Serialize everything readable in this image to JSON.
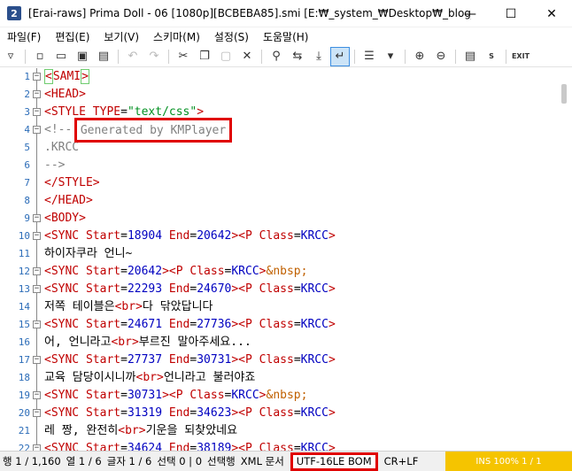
{
  "window": {
    "title": "[Erai-raws] Prima Doll - 06 [1080p][BCBEBA85].smi [E:₩_system_₩Desktop₩_blog_te...",
    "app_icon": "2",
    "controls": [
      "—",
      "☐",
      "✕"
    ]
  },
  "menu": [
    "파일(F)",
    "편집(E)",
    "보기(V)",
    "스키마(M)",
    "설정(S)",
    "도움말(H)"
  ],
  "toolbar": {
    "exit_label": "EXIT",
    "s_label": "S"
  },
  "editor": {
    "lines": [
      {
        "num": "1",
        "fold": "box-minus",
        "segments": [
          {
            "cls": "tag brace-box",
            "t": "<"
          },
          {
            "cls": "tag",
            "t": "SAMI"
          },
          {
            "cls": "tag brace-box",
            "t": ">"
          }
        ]
      },
      {
        "num": "2",
        "fold": "box-minus",
        "segments": [
          {
            "cls": "tag",
            "t": "<HEAD>"
          }
        ]
      },
      {
        "num": "3",
        "fold": "box-minus",
        "segments": [
          {
            "cls": "tag",
            "t": "<STYLE "
          },
          {
            "cls": "attr",
            "t": "TYPE"
          },
          {
            "cls": "plain",
            "t": "="
          },
          {
            "cls": "str",
            "t": "\"text/css\""
          },
          {
            "cls": "tag",
            "t": ">"
          }
        ]
      },
      {
        "num": "4",
        "fold": "box-minus",
        "segments": [
          {
            "cls": "cmt",
            "t": "<!--"
          }
        ]
      },
      {
        "num": "5",
        "fold": "line",
        "segments": [
          {
            "cls": "cmt",
            "t": ".KRCC"
          }
        ]
      },
      {
        "num": "6",
        "fold": "line",
        "segments": [
          {
            "cls": "cmt",
            "t": "-->"
          }
        ]
      },
      {
        "num": "7",
        "fold": "line",
        "segments": [
          {
            "cls": "tag",
            "t": "</STYLE>"
          }
        ]
      },
      {
        "num": "8",
        "fold": "line",
        "segments": [
          {
            "cls": "tag",
            "t": "</HEAD>"
          }
        ]
      },
      {
        "num": "9",
        "fold": "box-minus",
        "segments": [
          {
            "cls": "tag",
            "t": "<BODY>"
          }
        ]
      },
      {
        "num": "10",
        "fold": "box-minus",
        "segments": [
          {
            "cls": "tag",
            "t": "<SYNC "
          },
          {
            "cls": "attr",
            "t": "Start"
          },
          {
            "cls": "plain",
            "t": "="
          },
          {
            "cls": "val",
            "t": "18904"
          },
          {
            "cls": "attr",
            "t": " End"
          },
          {
            "cls": "plain",
            "t": "="
          },
          {
            "cls": "val",
            "t": "20642"
          },
          {
            "cls": "tag",
            "t": "><P "
          },
          {
            "cls": "attr",
            "t": "Class"
          },
          {
            "cls": "plain",
            "t": "="
          },
          {
            "cls": "val",
            "t": "KRCC"
          },
          {
            "cls": "tag",
            "t": ">"
          }
        ]
      },
      {
        "num": "11",
        "fold": "line",
        "segments": [
          {
            "cls": "plain",
            "t": "하이자쿠라 언니~"
          }
        ]
      },
      {
        "num": "12",
        "fold": "box-minus",
        "segments": [
          {
            "cls": "tag",
            "t": "<SYNC "
          },
          {
            "cls": "attr",
            "t": "Start"
          },
          {
            "cls": "plain",
            "t": "="
          },
          {
            "cls": "val",
            "t": "20642"
          },
          {
            "cls": "tag",
            "t": "><P "
          },
          {
            "cls": "attr",
            "t": "Class"
          },
          {
            "cls": "plain",
            "t": "="
          },
          {
            "cls": "val",
            "t": "KRCC"
          },
          {
            "cls": "tag",
            "t": ">"
          },
          {
            "cls": "ent",
            "t": "&nbsp;"
          }
        ]
      },
      {
        "num": "13",
        "fold": "box-minus",
        "segments": [
          {
            "cls": "tag",
            "t": "<SYNC "
          },
          {
            "cls": "attr",
            "t": "Start"
          },
          {
            "cls": "plain",
            "t": "="
          },
          {
            "cls": "val",
            "t": "22293"
          },
          {
            "cls": "attr",
            "t": " End"
          },
          {
            "cls": "plain",
            "t": "="
          },
          {
            "cls": "val",
            "t": "24670"
          },
          {
            "cls": "tag",
            "t": "><P "
          },
          {
            "cls": "attr",
            "t": "Class"
          },
          {
            "cls": "plain",
            "t": "="
          },
          {
            "cls": "val",
            "t": "KRCC"
          },
          {
            "cls": "tag",
            "t": ">"
          }
        ]
      },
      {
        "num": "14",
        "fold": "line",
        "segments": [
          {
            "cls": "plain",
            "t": "저쪽 테이블은"
          },
          {
            "cls": "tag",
            "t": "<br>"
          },
          {
            "cls": "plain",
            "t": "다 닦았답니다"
          }
        ]
      },
      {
        "num": "15",
        "fold": "box-minus",
        "segments": [
          {
            "cls": "tag",
            "t": "<SYNC "
          },
          {
            "cls": "attr",
            "t": "Start"
          },
          {
            "cls": "plain",
            "t": "="
          },
          {
            "cls": "val",
            "t": "24671"
          },
          {
            "cls": "attr",
            "t": " End"
          },
          {
            "cls": "plain",
            "t": "="
          },
          {
            "cls": "val",
            "t": "27736"
          },
          {
            "cls": "tag",
            "t": "><P "
          },
          {
            "cls": "attr",
            "t": "Class"
          },
          {
            "cls": "plain",
            "t": "="
          },
          {
            "cls": "val",
            "t": "KRCC"
          },
          {
            "cls": "tag",
            "t": ">"
          }
        ]
      },
      {
        "num": "16",
        "fold": "line",
        "segments": [
          {
            "cls": "plain",
            "t": "어, 언니라고"
          },
          {
            "cls": "tag",
            "t": "<br>"
          },
          {
            "cls": "plain",
            "t": "부르진 말아주세요..."
          }
        ]
      },
      {
        "num": "17",
        "fold": "box-minus",
        "segments": [
          {
            "cls": "tag",
            "t": "<SYNC "
          },
          {
            "cls": "attr",
            "t": "Start"
          },
          {
            "cls": "plain",
            "t": "="
          },
          {
            "cls": "val",
            "t": "27737"
          },
          {
            "cls": "attr",
            "t": " End"
          },
          {
            "cls": "plain",
            "t": "="
          },
          {
            "cls": "val",
            "t": "30731"
          },
          {
            "cls": "tag",
            "t": "><P "
          },
          {
            "cls": "attr",
            "t": "Class"
          },
          {
            "cls": "plain",
            "t": "="
          },
          {
            "cls": "val",
            "t": "KRCC"
          },
          {
            "cls": "tag",
            "t": ">"
          }
        ]
      },
      {
        "num": "18",
        "fold": "line",
        "segments": [
          {
            "cls": "plain",
            "t": "교육 담당이시니까"
          },
          {
            "cls": "tag",
            "t": "<br>"
          },
          {
            "cls": "plain",
            "t": "언니라고 불러야죠"
          }
        ]
      },
      {
        "num": "19",
        "fold": "box-minus",
        "segments": [
          {
            "cls": "tag",
            "t": "<SYNC "
          },
          {
            "cls": "attr",
            "t": "Start"
          },
          {
            "cls": "plain",
            "t": "="
          },
          {
            "cls": "val",
            "t": "30731"
          },
          {
            "cls": "tag",
            "t": "><P "
          },
          {
            "cls": "attr",
            "t": "Class"
          },
          {
            "cls": "plain",
            "t": "="
          },
          {
            "cls": "val",
            "t": "KRCC"
          },
          {
            "cls": "tag",
            "t": ">"
          },
          {
            "cls": "ent",
            "t": "&nbsp;"
          }
        ]
      },
      {
        "num": "20",
        "fold": "box-minus",
        "segments": [
          {
            "cls": "tag",
            "t": "<SYNC "
          },
          {
            "cls": "attr",
            "t": "Start"
          },
          {
            "cls": "plain",
            "t": "="
          },
          {
            "cls": "val",
            "t": "31319"
          },
          {
            "cls": "attr",
            "t": " End"
          },
          {
            "cls": "plain",
            "t": "="
          },
          {
            "cls": "val",
            "t": "34623"
          },
          {
            "cls": "tag",
            "t": "><P "
          },
          {
            "cls": "attr",
            "t": "Class"
          },
          {
            "cls": "plain",
            "t": "="
          },
          {
            "cls": "val",
            "t": "KRCC"
          },
          {
            "cls": "tag",
            "t": ">"
          }
        ]
      },
      {
        "num": "21",
        "fold": "line",
        "segments": [
          {
            "cls": "plain",
            "t": "레 짱, 완전히"
          },
          {
            "cls": "tag",
            "t": "<br>"
          },
          {
            "cls": "plain",
            "t": "기운을 되찾았네요"
          }
        ]
      },
      {
        "num": "22",
        "fold": "box-minus",
        "segments": [
          {
            "cls": "tag",
            "t": "<SYNC "
          },
          {
            "cls": "attr",
            "t": "Start"
          },
          {
            "cls": "plain",
            "t": "="
          },
          {
            "cls": "val",
            "t": "34624"
          },
          {
            "cls": "attr",
            "t": " End"
          },
          {
            "cls": "plain",
            "t": "="
          },
          {
            "cls": "val",
            "t": "38189"
          },
          {
            "cls": "tag",
            "t": "><P "
          },
          {
            "cls": "attr",
            "t": "Class"
          },
          {
            "cls": "plain",
            "t": "="
          },
          {
            "cls": "val",
            "t": "KRCC"
          },
          {
            "cls": "tag",
            "t": ">"
          }
        ]
      }
    ],
    "generated_label": "Generated by KMPlayer"
  },
  "status": {
    "line": "행 1 / 1,160",
    "col": "열 1 / 6",
    "char": "글자 1 / 6",
    "selection": "선택 0 | 0",
    "select_mode": "선택행",
    "doc_type": "XML 문서",
    "encoding": "UTF-16LE BOM",
    "eol": "CR+LF",
    "extra": "INS  100%  1 / 1"
  },
  "colors": {
    "tag": "#c00000",
    "value": "#0000c0",
    "string": "#009020",
    "entity": "#c06000",
    "comment": "#808080",
    "highlight": "#e00000",
    "line_number": "#2b6cb8"
  }
}
